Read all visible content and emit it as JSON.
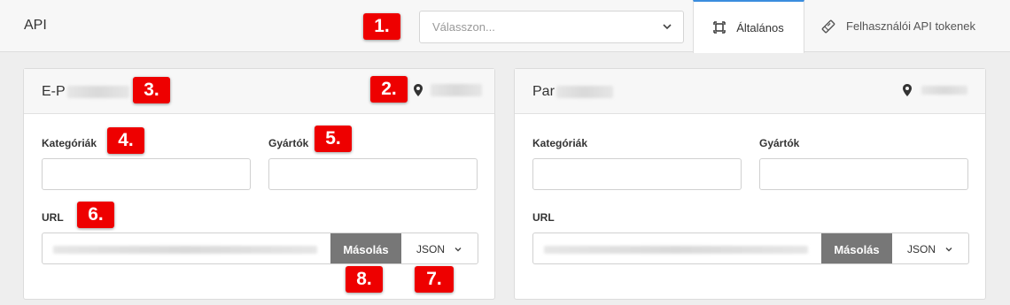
{
  "header": {
    "title": "API",
    "select_placeholder": "Válasszon...",
    "tabs": [
      {
        "label": "Általános",
        "icon": "frame-icon",
        "active": true
      },
      {
        "label": "Felhasználói API tokenek",
        "icon": "ticket-icon",
        "active": false
      }
    ]
  },
  "panels": [
    {
      "title": "E-P",
      "categories_label": "Kategóriák",
      "manufacturers_label": "Gyártók",
      "url_label": "URL",
      "copy_label": "Másolás",
      "format_label": "JSON"
    },
    {
      "title": "Par",
      "categories_label": "Kategóriák",
      "manufacturers_label": "Gyártók",
      "url_label": "URL",
      "copy_label": "Másolás",
      "format_label": "JSON"
    }
  ],
  "annotations": [
    "1.",
    "2.",
    "3.",
    "4.",
    "5.",
    "6.",
    "7.",
    "8."
  ],
  "colors": {
    "accent": "#3a8dde",
    "badge": "#ee0000",
    "copy_button": "#777777"
  }
}
